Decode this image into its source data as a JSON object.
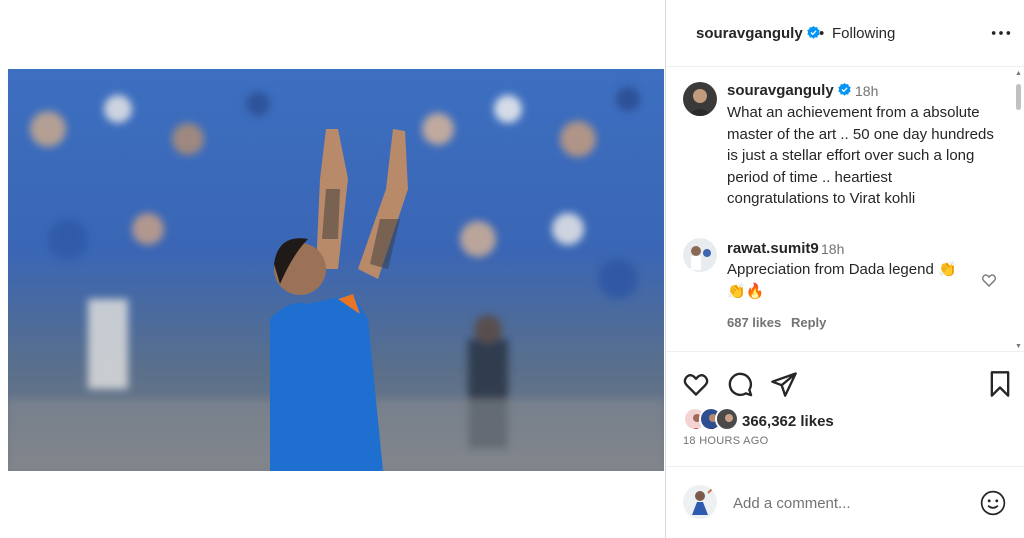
{
  "post": {
    "username": "souravganguly",
    "separator": "•",
    "follow_status": "Following",
    "media_description_icon": "photo"
  },
  "comments": [
    {
      "username": "souravganguly",
      "time": "18h",
      "lines": [
        "What an achievement from a absolute",
        "master of the art .. 50 one day hundreds",
        "is just a stellar effort over such a long",
        "period of time .. heartiest",
        "congratulations to Virat kohli"
      ]
    },
    {
      "username": "rawat.sumit9",
      "time": "18h",
      "lines": [
        "Appreciation from Dada legend 👏",
        "👏🔥"
      ],
      "likes": "687 likes",
      "reply": "Reply"
    }
  ],
  "engagement": {
    "likes": "366,362 likes",
    "posted": "18 HOURS AGO"
  },
  "composer": {
    "placeholder": "Add a comment..."
  },
  "colors": {
    "verified": "#0095f6",
    "text": "#262626",
    "secondary": "#737373"
  }
}
